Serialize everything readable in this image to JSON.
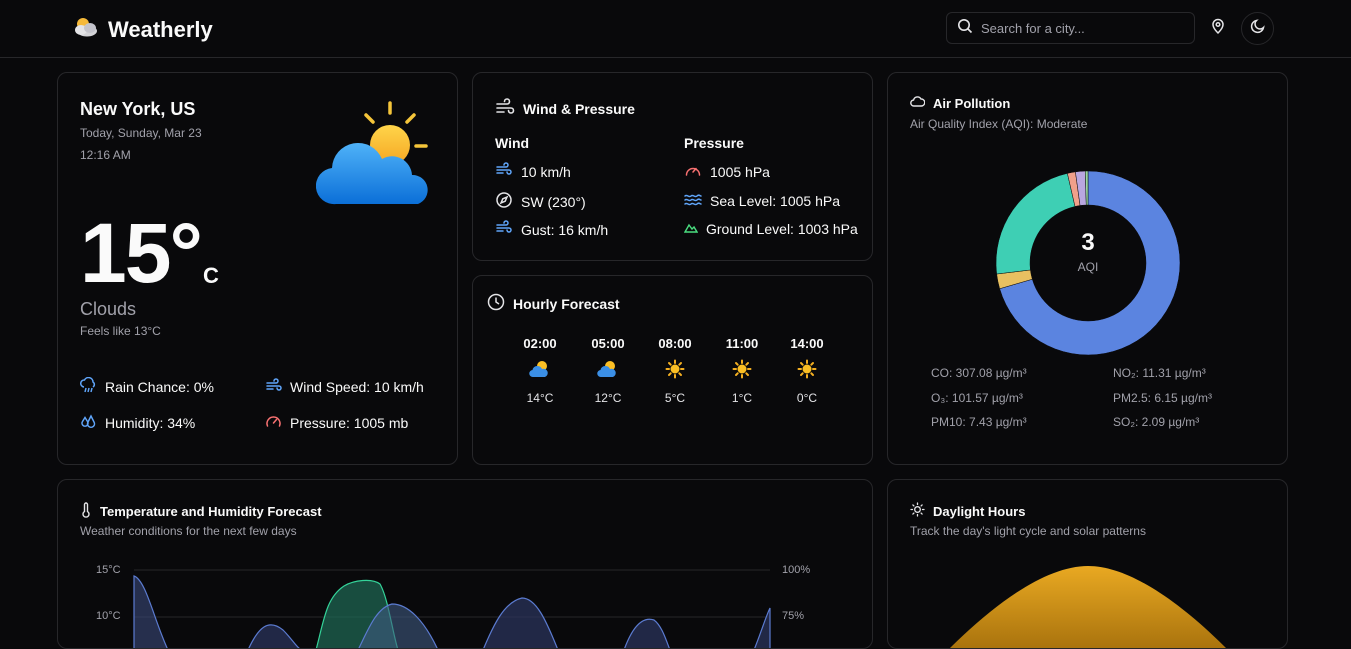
{
  "header": {
    "title": "Weatherly",
    "search_placeholder": "Search for a city..."
  },
  "current": {
    "city": "New York, US",
    "date": "Today, Sunday, Mar 23",
    "time": "12:16 AM",
    "temperature": "15°",
    "unit": "C",
    "condition": "Clouds",
    "feels_like": "Feels like 13°C",
    "rain_chance": "Rain Chance: 0%",
    "wind_speed": "Wind Speed: 10 km/h",
    "humidity": "Humidity: 34%",
    "pressure": "Pressure: 1005 mb"
  },
  "wind_pressure": {
    "title": "Wind & Pressure",
    "wind_heading": "Wind",
    "pressure_heading": "Pressure",
    "wind_speed": "10 km/h",
    "direction": "SW (230°)",
    "gust": "Gust: 16 km/h",
    "pressure": "1005 hPa",
    "sea_level": "Sea Level: 1005 hPa",
    "ground_level": "Ground Level: 1003 hPa"
  },
  "hourly": {
    "title": "Hourly Forecast",
    "items": [
      {
        "time": "02:00",
        "temp": "14°C",
        "icon": "partly-cloudy-icon"
      },
      {
        "time": "05:00",
        "temp": "12°C",
        "icon": "partly-cloudy-icon"
      },
      {
        "time": "08:00",
        "temp": "5°C",
        "icon": "sun-icon"
      },
      {
        "time": "11:00",
        "temp": "1°C",
        "icon": "sun-icon"
      },
      {
        "time": "14:00",
        "temp": "0°C",
        "icon": "sun-icon"
      }
    ]
  },
  "air": {
    "title": "Air Pollution",
    "subtitle": "Air Quality Index (AQI): Moderate",
    "aqi": "3",
    "aqi_label": "AQI",
    "co": "CO: 307.08 µg/m³",
    "no2": "NO₂: 11.31 µg/m³",
    "o3": "O₃: 101.57 µg/m³",
    "pm25": "PM2.5: 6.15 µg/m³",
    "pm10": "PM10: 7.43 µg/m³",
    "so2": "SO₂: 2.09 µg/m³",
    "colors": [
      "#5b84e0",
      "#e8c061",
      "#3ecfb4",
      "#f0a08a",
      "#b9a7e0",
      "#9ad9a0"
    ]
  },
  "temp_humidity": {
    "title": "Temperature and Humidity Forecast",
    "subtitle": "Weather conditions for the next few days",
    "y_left": [
      "15°C",
      "10°C"
    ],
    "y_right": [
      "100%",
      "75%"
    ]
  },
  "daylight": {
    "title": "Daylight Hours",
    "subtitle": "Track the day's light cycle and solar patterns"
  },
  "chart_data": {
    "type": "pie",
    "categories": [
      "CO",
      "NO₂",
      "O₃",
      "PM2.5",
      "PM10",
      "SO₂"
    ],
    "values": [
      307.08,
      11.31,
      101.57,
      6.15,
      7.43,
      2.09
    ]
  }
}
